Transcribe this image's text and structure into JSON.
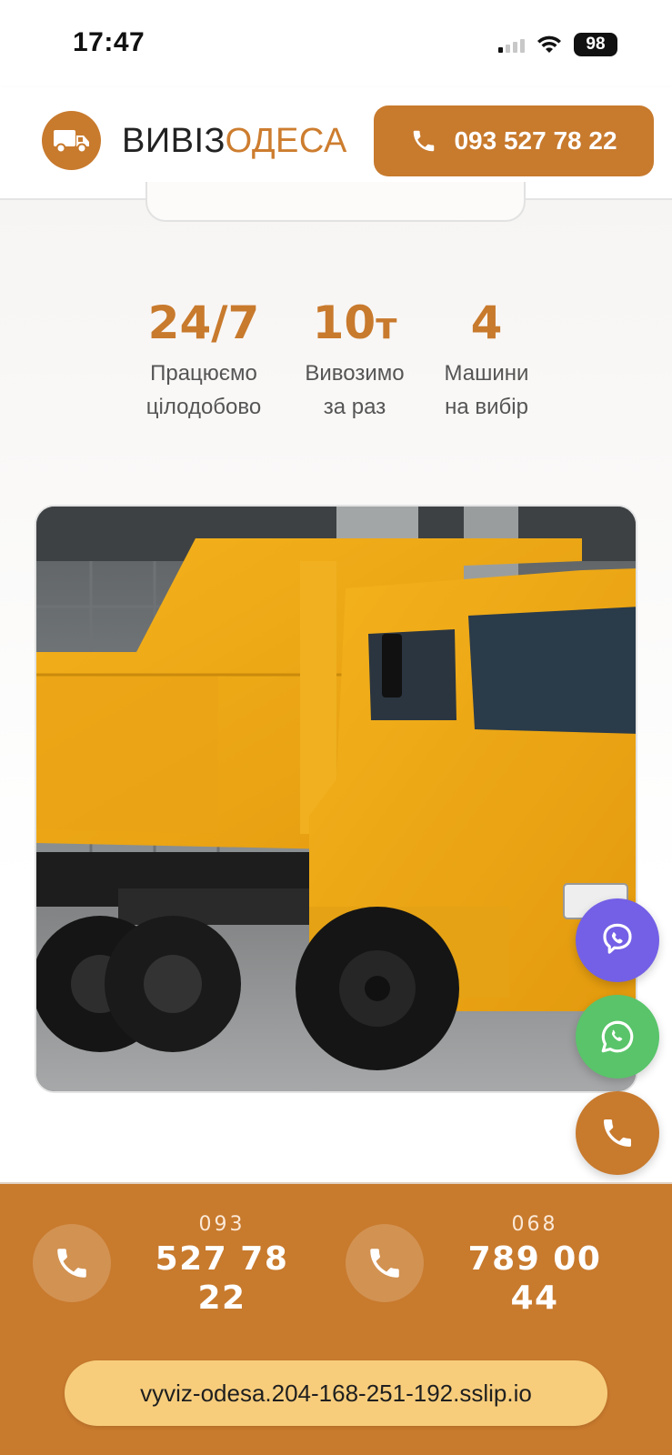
{
  "status_bar": {
    "time": "17:47",
    "battery": "98"
  },
  "header": {
    "logo_part1": "ВИВІЗ",
    "logo_part2": "ОДЕСА",
    "phone_label": "093 527 78 22"
  },
  "stats": [
    {
      "value": "24/7",
      "unit": "",
      "label_line1": "Працюємо",
      "label_line2": "цілодобово"
    },
    {
      "value": "10",
      "unit": "т",
      "label_line1": "Вивозимо",
      "label_line2": "за раз"
    },
    {
      "value": "4",
      "unit": "",
      "label_line1": "Машини",
      "label_line2": "на вибір"
    }
  ],
  "contacts": [
    {
      "prefix": "093",
      "number_line1": "527 78",
      "number_line2": "22"
    },
    {
      "prefix": "068",
      "number_line1": "789 00",
      "number_line2": "44"
    }
  ],
  "url": "vyviz-odesa.204-168-251-192.sslip.io",
  "colors": {
    "accent": "#c87a2d",
    "viber": "#7360e6",
    "whatsapp": "#59c46a",
    "url_pill": "#f7cd7c"
  },
  "icons": [
    "truck-icon",
    "phone-icon",
    "viber-icon",
    "whatsapp-icon",
    "wifi-icon",
    "signal-icon",
    "battery-icon"
  ]
}
